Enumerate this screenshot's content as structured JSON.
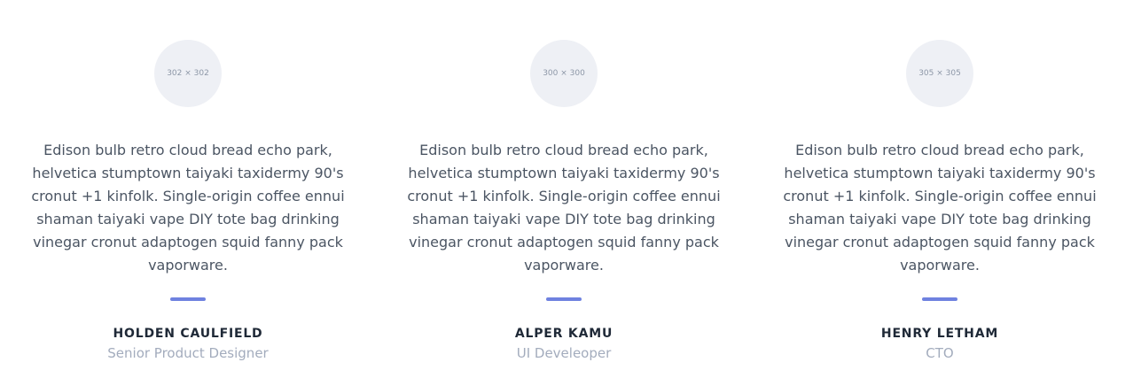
{
  "testimonials": [
    {
      "avatar_label": "302 × 302",
      "quote": "Edison bulb retro cloud bread echo park, helvetica stumptown taiyaki taxidermy 90's cronut +1 kinfolk. Single-origin coffee ennui shaman taiyaki vape DIY tote bag drinking vinegar cronut adaptogen squid fanny pack vaporware.",
      "name": "HOLDEN CAULFIELD",
      "role": "Senior Product Designer"
    },
    {
      "avatar_label": "300 × 300",
      "quote": "Edison bulb retro cloud bread echo park, helvetica stumptown taiyaki taxidermy 90's cronut +1 kinfolk. Single-origin coffee ennui shaman taiyaki vape DIY tote bag drinking vinegar cronut adaptogen squid fanny pack vaporware.",
      "name": "ALPER KAMU",
      "role": "UI Develeoper"
    },
    {
      "avatar_label": "305 × 305",
      "quote": "Edison bulb retro cloud bread echo park, helvetica stumptown taiyaki taxidermy 90's cronut +1 kinfolk. Single-origin coffee ennui shaman taiyaki vape DIY tote bag drinking vinegar cronut adaptogen squid fanny pack vaporware.",
      "name": "HENRY LETHAM",
      "role": "CTO"
    }
  ],
  "colors": {
    "accent": "#6f82e0",
    "avatar_bg": "#eef0f5",
    "text": "#4b5563",
    "name": "#1f2937",
    "role": "#a3acbd"
  }
}
